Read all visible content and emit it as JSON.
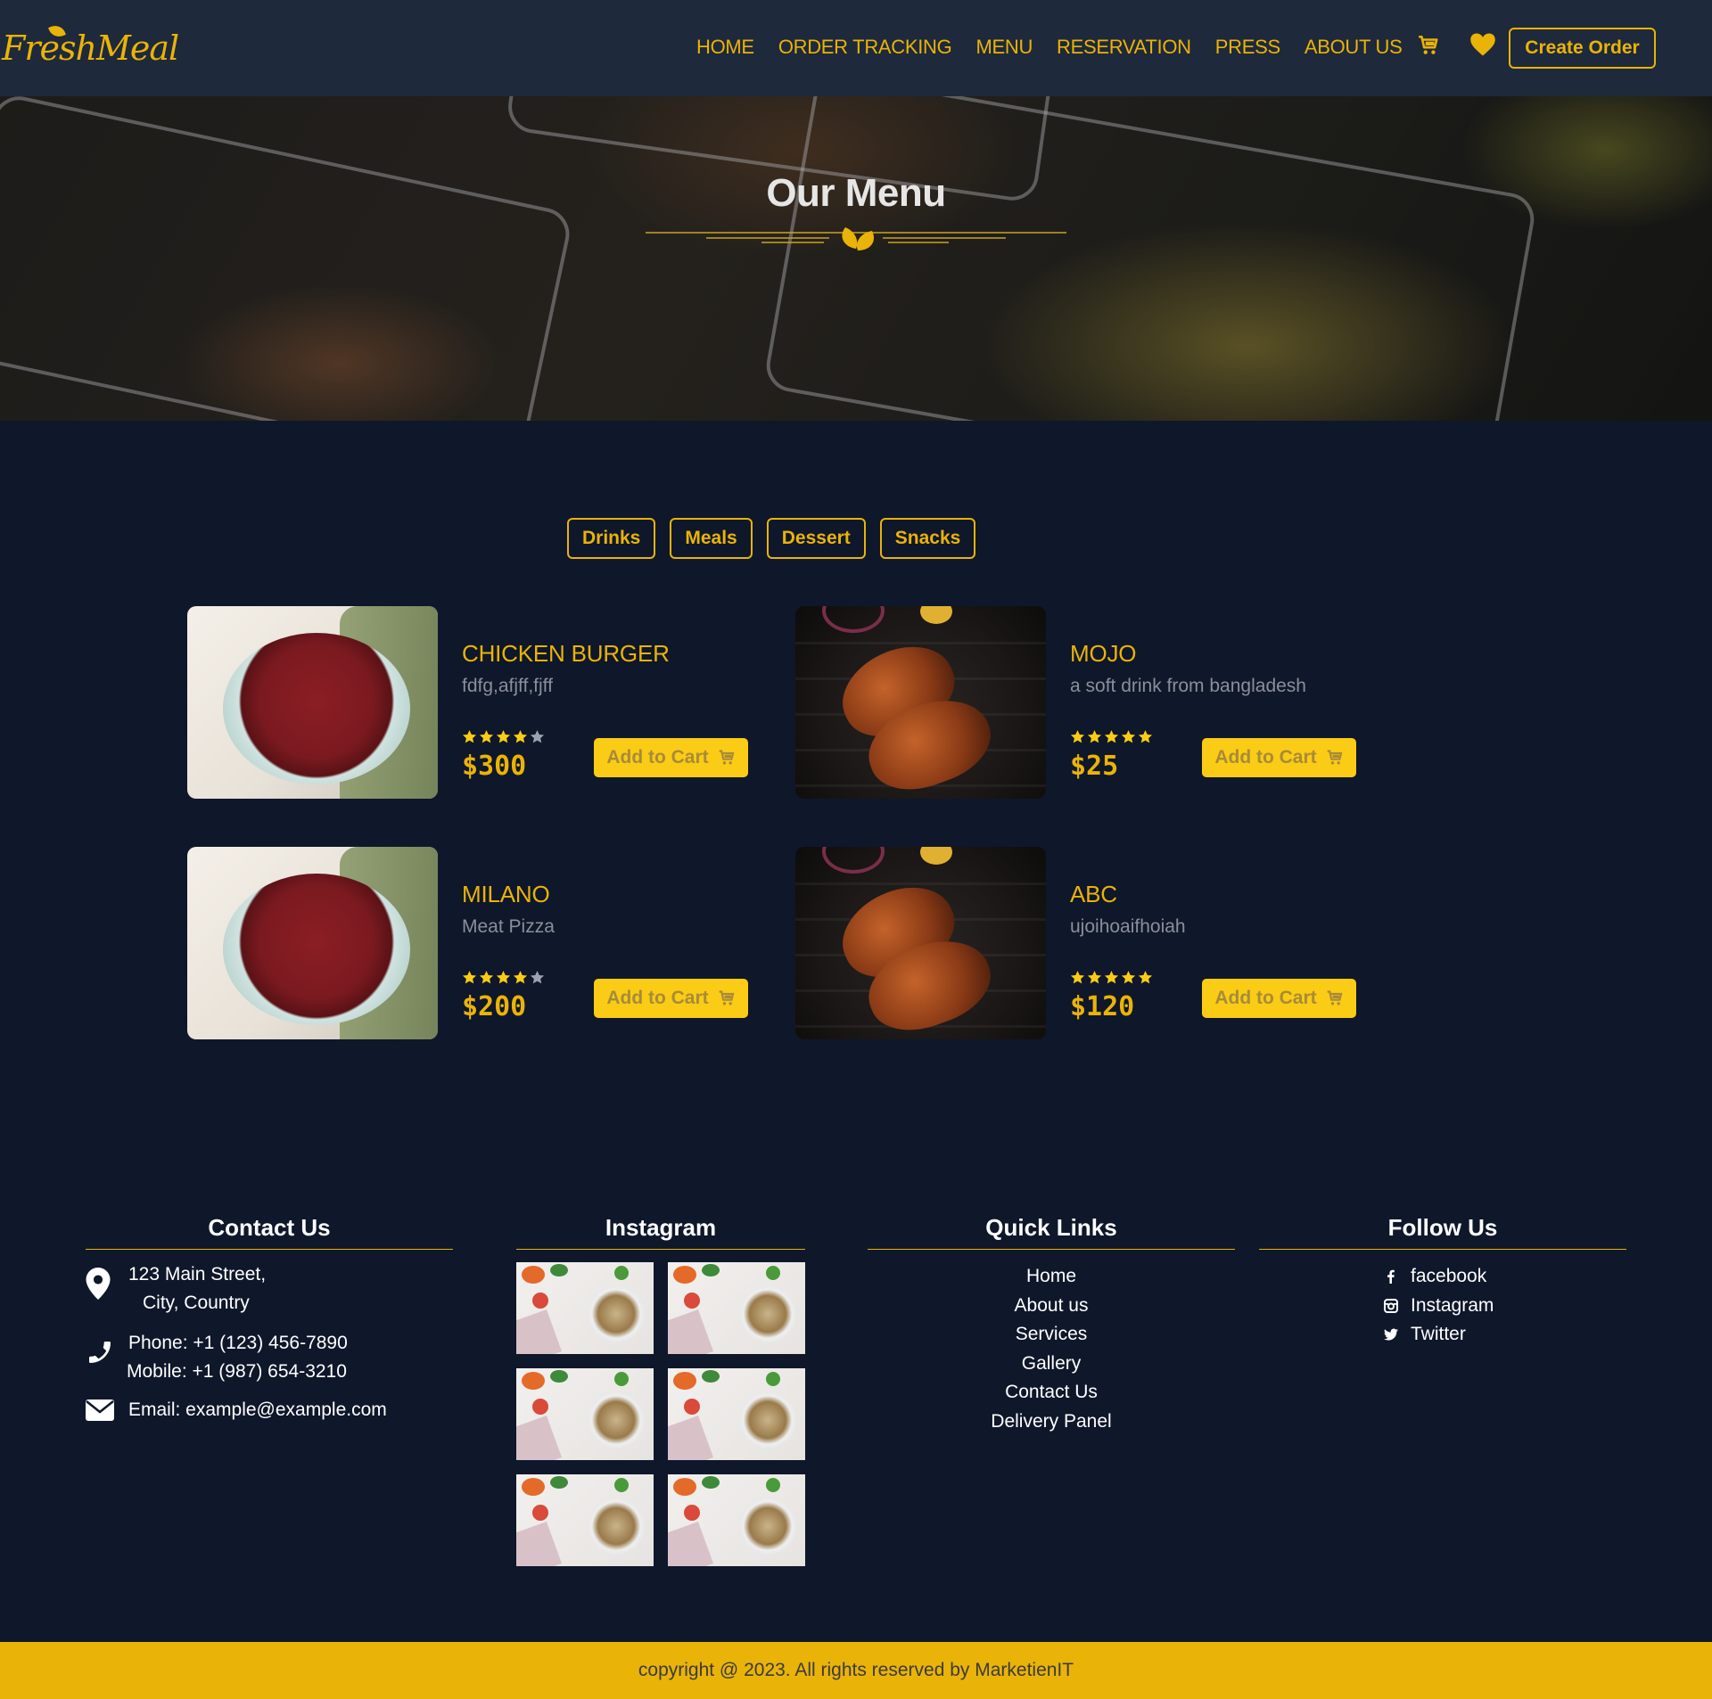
{
  "brand": {
    "name": "FreshMeal"
  },
  "nav": {
    "items": [
      "HOME",
      "ORDER TRACKING",
      "MENU",
      "RESERVATION",
      "PRESS",
      "ABOUT US"
    ],
    "cart_icon": "cart-icon",
    "wishlist_icon": "heart-icon",
    "create_order": "Create Order"
  },
  "hero": {
    "title": "Our Menu"
  },
  "categories": [
    "Drinks",
    "Meals",
    "Dessert",
    "Snacks"
  ],
  "products": [
    {
      "name": "CHICKEN BURGER",
      "desc": "fdfg,afjff,fjff",
      "rating": 4,
      "price": "$300",
      "cta": "Add to Cart",
      "image": "bowl"
    },
    {
      "name": "MOJO",
      "desc": "a soft drink from bangladesh",
      "rating": 5,
      "price": "$25",
      "cta": "Add to Cart",
      "image": "grill"
    },
    {
      "name": "MILANO",
      "desc": "Meat Pizza",
      "rating": 4,
      "price": "$200",
      "cta": "Add to Cart",
      "image": "bowl"
    },
    {
      "name": "ABC",
      "desc": "ujoihoaifhoiah",
      "rating": 5,
      "price": "$120",
      "cta": "Add to Cart",
      "image": "grill"
    }
  ],
  "footer": {
    "contact": {
      "title": "Contact Us",
      "address_line1": "123 Main Street,",
      "address_line2": "City, Country",
      "phone": "Phone: +1 (123) 456-7890",
      "mobile": "Mobile: +1 (987) 654-3210",
      "email": "Email: example@example.com"
    },
    "instagram": {
      "title": "Instagram",
      "count": 6
    },
    "quick_links": {
      "title": "Quick Links",
      "items": [
        "Home",
        "About us",
        "Services",
        "Gallery",
        "Contact Us",
        "Delivery Panel"
      ]
    },
    "follow": {
      "title": "Follow Us",
      "items": [
        {
          "label": "facebook",
          "icon": "facebook-icon"
        },
        {
          "label": "Instagram",
          "icon": "instagram-icon"
        },
        {
          "label": "Twitter",
          "icon": "twitter-icon"
        }
      ]
    },
    "copyright": "copyright @ 2023. All rights reserved by MarketienIT"
  },
  "colors": {
    "accent": "#eab308",
    "background": "#0f172a",
    "nav_bg": "#1e293b",
    "button": "#facc15"
  }
}
